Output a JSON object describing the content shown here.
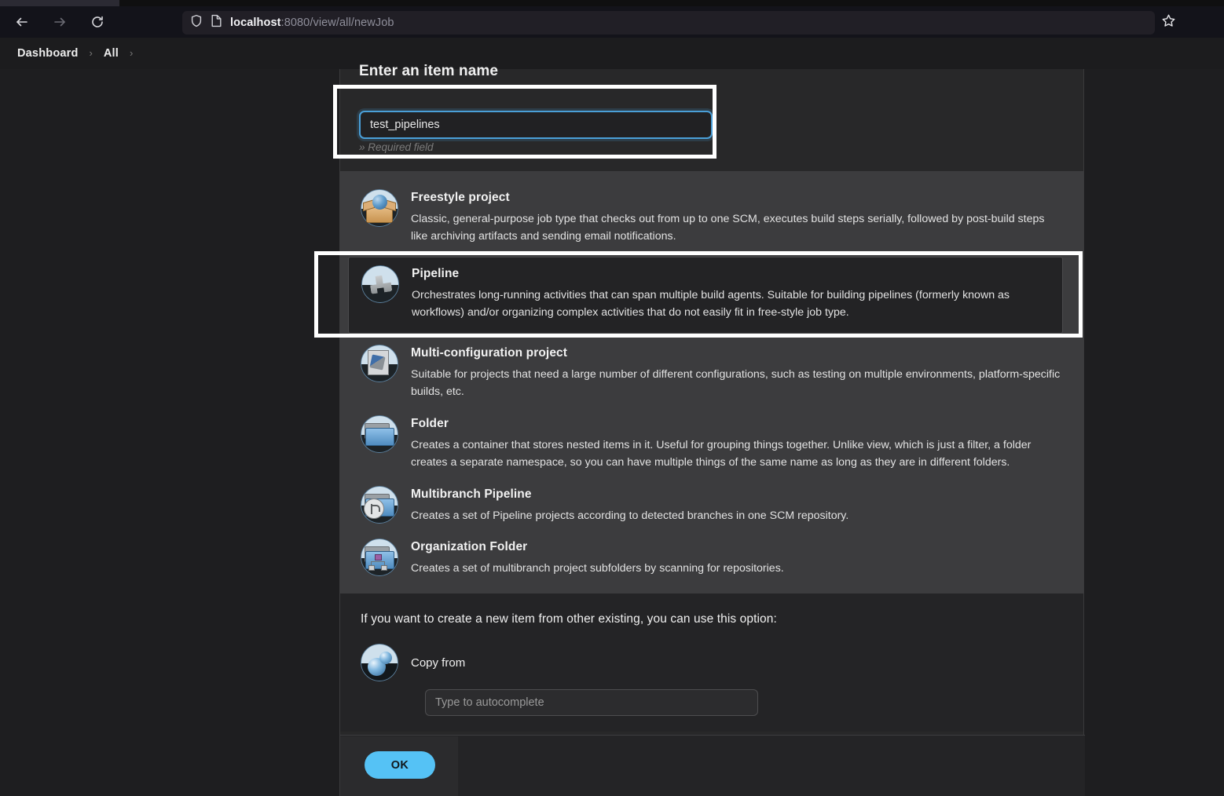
{
  "browser": {
    "back_icon": "arrow-left",
    "forward_icon": "arrow-right",
    "reload_icon": "reload",
    "shield_icon": "shield",
    "page_icon": "document",
    "bookmark_icon": "star",
    "url_host": "localhost",
    "url_rest": ":8080/view/all/newJob"
  },
  "breadcrumb": {
    "items": [
      {
        "label": "Dashboard"
      },
      {
        "label": "All"
      }
    ],
    "separator": "›"
  },
  "name_section": {
    "title": "Enter an item name",
    "value": "test_pipelines",
    "placeholder": "",
    "required_note": "» Required field"
  },
  "item_types": [
    {
      "name": "Freestyle project",
      "description": "Classic, general-purpose job type that checks out from up to one SCM, executes build steps serially, followed by post-build steps like archiving artifacts and sending email notifications.",
      "icon": "freestyle-project-icon"
    },
    {
      "name": "Pipeline",
      "description": "Orchestrates long-running activities that can span multiple build agents. Suitable for building pipelines (formerly known as workflows) and/or organizing complex activities that do not easily fit in free-style job type.",
      "icon": "pipeline-icon",
      "highlighted": true
    },
    {
      "name": "Multi-configuration project",
      "description": "Suitable for projects that need a large number of different configurations, such as testing on multiple environments, platform-specific builds, etc.",
      "icon": "multi-configuration-icon"
    },
    {
      "name": "Folder",
      "description": "Creates a container that stores nested items in it. Useful for grouping things together. Unlike view, which is just a filter, a folder creates a separate namespace, so you can have multiple things of the same name as long as they are in different folders.",
      "icon": "folder-icon"
    },
    {
      "name": "Multibranch Pipeline",
      "description": "Creates a set of Pipeline projects according to detected branches in one SCM repository.",
      "icon": "multibranch-pipeline-icon"
    },
    {
      "name": "Organization Folder",
      "description": "Creates a set of multibranch project subfolders by scanning for repositories.",
      "icon": "organization-folder-icon"
    }
  ],
  "copy_section": {
    "lead": "If you want to create a new item from other existing, you can use this option:",
    "label": "Copy from",
    "icon": "copy-from-icon",
    "input_value": "",
    "input_placeholder": "Type to autocomplete"
  },
  "footer": {
    "ok_label": "OK"
  },
  "colors": {
    "accent_blue": "#55c2f5",
    "focus_border": "#4a9fd8",
    "highlight_white": "#ffffff",
    "panel_bg": "#282829",
    "list_bg": "#3c3c3e",
    "page_bg": "#1e1e20"
  }
}
